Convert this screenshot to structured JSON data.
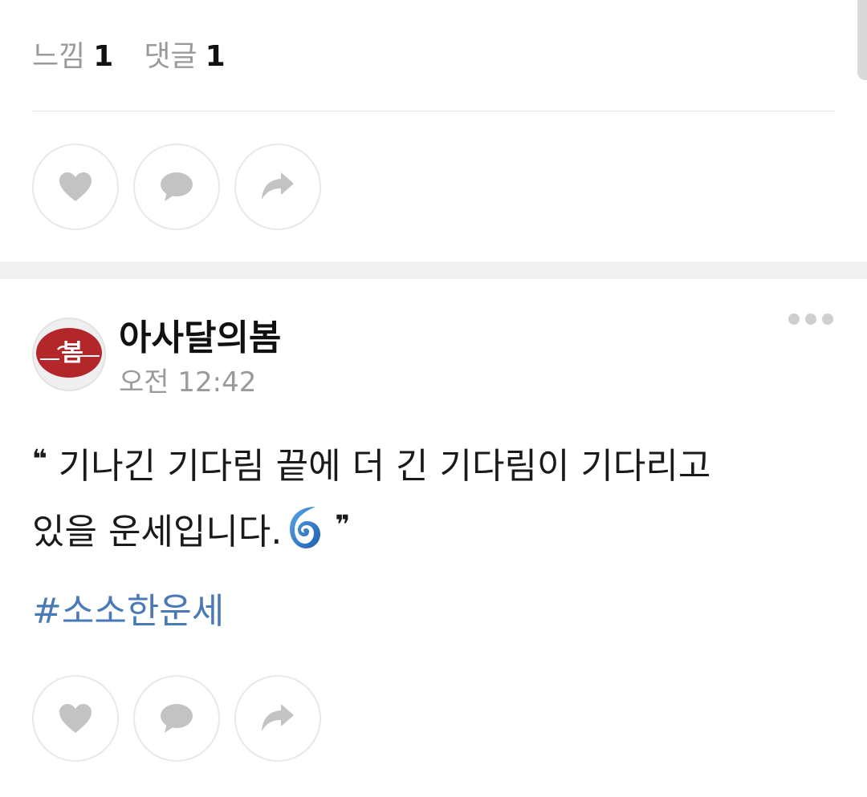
{
  "prev_post": {
    "likes_label": "느낌",
    "likes_count": "1",
    "comments_label": "댓글",
    "comments_count": "1"
  },
  "post": {
    "author": "아사달의봄",
    "timestamp": "오전 12:42",
    "quote_open": "❝",
    "body_line1": "기나긴 기다림 끝에 더 긴 기다림이 기다리고",
    "body_line2": "있을 운세입니다.",
    "quote_close": "❞",
    "hashtag": "#소소한운세",
    "avatar_text": "봄"
  },
  "icons": {
    "like": "heart-icon",
    "comment": "speech-bubble-icon",
    "share": "share-arrow-icon",
    "more": "more-dots-icon",
    "emoji": "cyclone-icon"
  },
  "colors": {
    "hashtag": "#4a79b8",
    "icon_gray": "#c3c3c3",
    "avatar_red": "#b3262a"
  }
}
